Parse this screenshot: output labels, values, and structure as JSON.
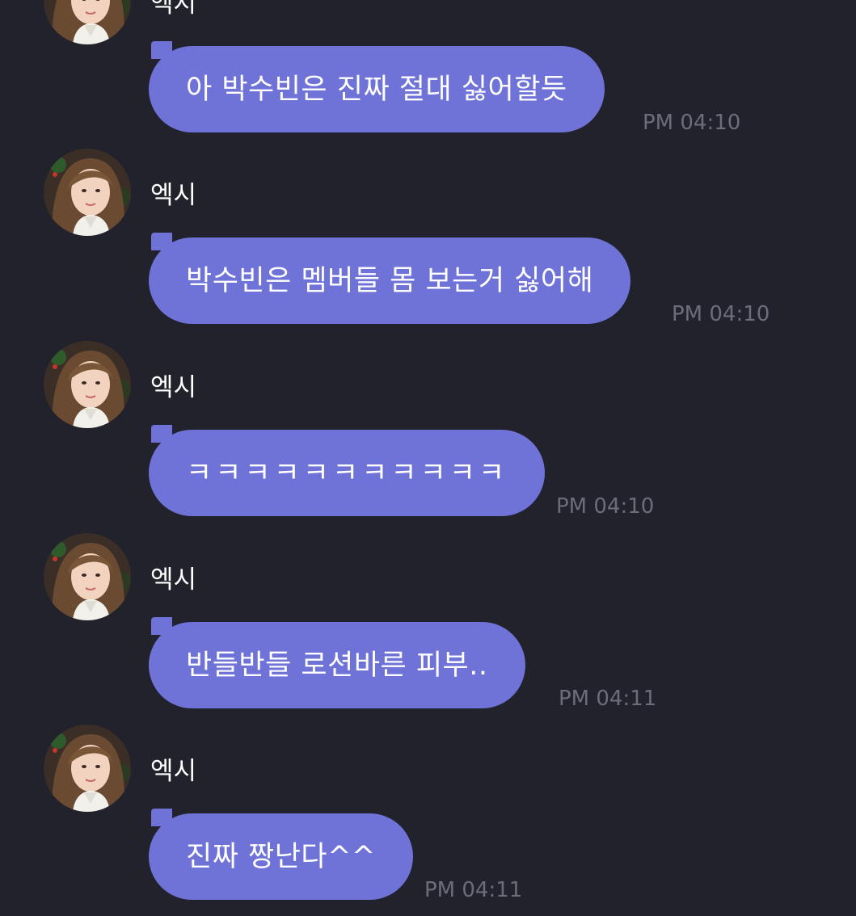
{
  "colors": {
    "background": "#21222c",
    "bubble": "#6f73d8",
    "text": "#ffffff",
    "timestamp": "#6b6d78"
  },
  "messages": [
    {
      "sender": "엑시",
      "text": "아 박수빈은 진짜 절대 싫어할듯",
      "time": "PM 04:10"
    },
    {
      "sender": "엑시",
      "text": "박수빈은 멤버들 몸 보는거 싫어해",
      "time": "PM 04:10"
    },
    {
      "sender": "엑시",
      "text": "ㅋㅋㅋㅋㅋㅋㅋㅋㅋㅋㅋ",
      "time": "PM 04:10"
    },
    {
      "sender": "엑시",
      "text": "반들반들 로션바른 피부..",
      "time": "PM 04:11"
    },
    {
      "sender": "엑시",
      "text": "진짜 짱난다^^",
      "time": "PM 04:11"
    }
  ]
}
